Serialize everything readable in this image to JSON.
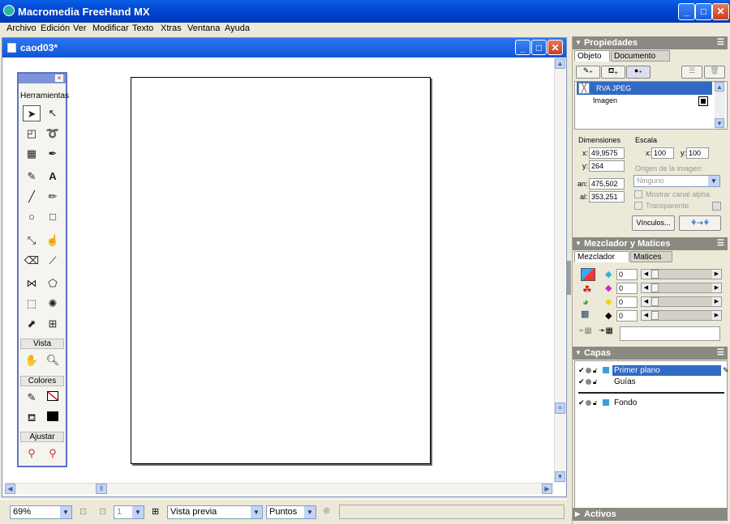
{
  "app": {
    "title": "Macromedia FreeHand MX"
  },
  "menu": [
    "Archivo",
    "Edición",
    "Ver",
    "Modificar",
    "Texto",
    "Xtras",
    "Ventana",
    "Ayuda"
  ],
  "document": {
    "title": "caod03*"
  },
  "toolbox": {
    "title": "Herramientas",
    "sections": {
      "vista": "Vista",
      "colores": "Colores",
      "ajustar": "Ajustar"
    }
  },
  "status": {
    "zoom": "69%",
    "page": "1",
    "view_mode": "Vista previa",
    "units": "Puntos"
  },
  "properties": {
    "title": "Propiedades",
    "tabs": [
      "Objeto",
      "Documento"
    ],
    "active_tab": "Objeto",
    "object_name": "RVA JPEG",
    "object_sub": "Imagen",
    "dimensions_label": "Dimensiones",
    "scale_label": "Escala",
    "x_label": "x:",
    "x_value": "49,9575",
    "y_label": "y:",
    "y_value": "264",
    "w_label": "an:",
    "w_value": "475,502",
    "h_label": "al:",
    "h_value": "353,251",
    "scale_x_label": "x:",
    "scale_x": "100",
    "scale_y_label": "y:",
    "scale_y": "100",
    "origin_label": "Origen de la imagen:",
    "origin_value": "Ninguno",
    "alpha_label": "Mostrar canal alpha",
    "transparent_label": "Transparente",
    "links_button": "Vínculos..."
  },
  "mixer": {
    "title": "Mezclador y Matices",
    "tabs": [
      "Mezclador",
      "Matices"
    ],
    "active_tab": "Mezclador",
    "channels": [
      {
        "name": "cyan",
        "value": "0",
        "color": "#2bb6d6"
      },
      {
        "name": "magenta",
        "value": "0",
        "color": "#d028c8"
      },
      {
        "name": "yellow",
        "value": "0",
        "color": "#e8dc10"
      },
      {
        "name": "black",
        "value": "0",
        "color": "#000000"
      }
    ]
  },
  "layers": {
    "title": "Capas",
    "items": [
      {
        "name": "Primer plano",
        "selected": true
      },
      {
        "name": "Guías",
        "selected": false
      },
      {
        "name": "Fondo",
        "selected": false
      }
    ]
  },
  "actives": {
    "title": "Activos"
  },
  "colors": {
    "titlebar": "#0a5ee6",
    "selection": "#316ac5",
    "layer_swatch": "#3aa0dc"
  }
}
